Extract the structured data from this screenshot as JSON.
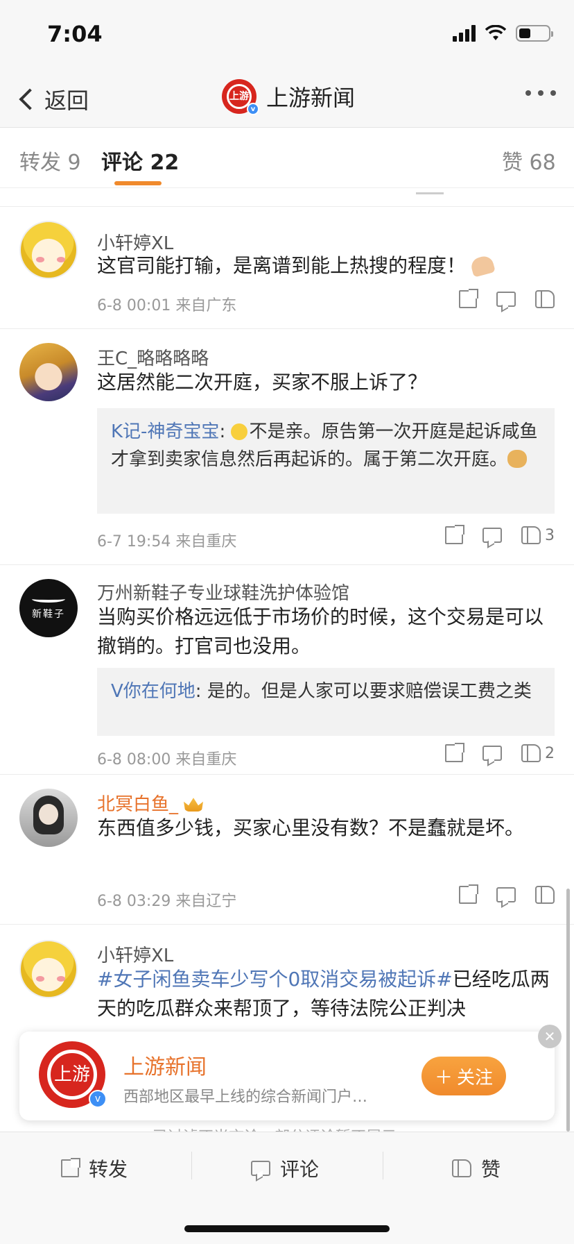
{
  "status_bar": {
    "time": "7:04"
  },
  "nav": {
    "back_label": "返回",
    "title": "上游新闻",
    "avatar_text": "上游"
  },
  "tabs": {
    "repost": "转发 9",
    "comment": "评论 22",
    "like": "赞 68"
  },
  "comments": [
    {
      "username": "小轩婷XL",
      "text": "这官司能打输，是离谱到能上热搜的程度！",
      "meta": "6-8 00:01  来自广东",
      "likes": ""
    },
    {
      "username": "王C_略略略略",
      "text": "这居然能二次开庭，买家不服上诉了？",
      "reply_name": "K记-神奇宝宝",
      "reply_text": "不是亲。原告第一次开庭是起诉咸鱼才拿到卖家信息然后再起诉的。属于第二次开庭。",
      "meta": "6-7 19:54  来自重庆",
      "likes": "3"
    },
    {
      "username": "万州新鞋子专业球鞋洗护体验馆",
      "avatar_text": "新鞋子",
      "text": "当购买价格远远低于市场价的时候，这个交易是可以撤销的。打官司也没用。",
      "reply_name": "V你在何地",
      "reply_text": "是的。但是人家可以要求赔偿误工费之类",
      "meta": "6-8 08:00  来自重庆",
      "likes": "2"
    },
    {
      "username": "北冥白鱼_",
      "text": "东西值多少钱，买家心里没有数？不是蠢就是坏。",
      "meta": "6-8 03:29  来自辽宁",
      "likes": ""
    },
    {
      "username": "小轩婷XL",
      "hashtag": "#女子闲鱼卖车少写个0取消交易被起诉#",
      "text": "已经吃瓜两天的吃瓜群众来帮顶了，等待法院公正判决"
    }
  ],
  "float_card": {
    "name": "上游新闻",
    "desc": "西部地区最早上线的综合新闻门户…",
    "follow_label": "关注",
    "avatar_text": "上游"
  },
  "filter_note": "已过滤不当言论，部分评论暂不展示",
  "bottom_bar": {
    "repost": "转发",
    "comment": "评论",
    "like": "赞"
  },
  "colors": {
    "accent": "#f08a2c",
    "link": "#4f76b6",
    "brand_red": "#d7261e",
    "vip_name": "#e7722b"
  }
}
